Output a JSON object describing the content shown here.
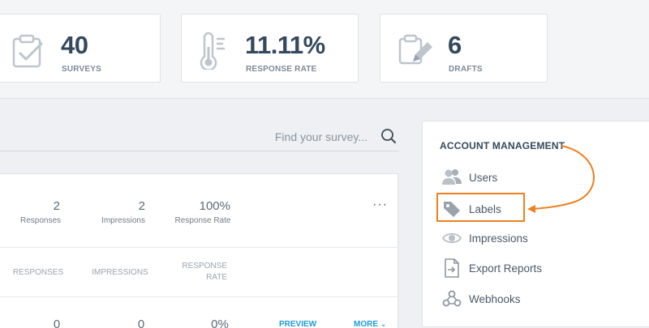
{
  "stats": [
    {
      "value": "40",
      "label": "SURVEYS",
      "icon": "clipboard-check-icon"
    },
    {
      "value": "11.11%",
      "label": "RESPONSE RATE",
      "icon": "thermometer-icon"
    },
    {
      "value": "6",
      "label": "DRAFTS",
      "icon": "clipboard-edit-icon"
    }
  ],
  "search": {
    "placeholder": "Find your survey..."
  },
  "survey_summary": {
    "responses": {
      "value": "2",
      "caption": "Responses"
    },
    "impressions": {
      "value": "2",
      "caption": "Impressions"
    },
    "response_rate": {
      "value": "100%",
      "caption": "Response Rate"
    },
    "more_menu": "···"
  },
  "table": {
    "headers": {
      "responses": "RESPONSES",
      "impressions": "IMPRESSIONS",
      "response_rate_1": "RESPONSE",
      "response_rate_2": "RATE"
    },
    "row": {
      "responses": "0",
      "impressions": "0",
      "response_rate": "0%",
      "preview": "PREVIEW",
      "more": "MORE"
    }
  },
  "account_management": {
    "title": "ACCOUNT MANAGEMENT",
    "items": [
      {
        "label": "Users",
        "icon": "users-icon"
      },
      {
        "label": "Labels",
        "icon": "tag-icon"
      },
      {
        "label": "Impressions",
        "icon": "eye-icon"
      },
      {
        "label": "Export Reports",
        "icon": "export-file-icon"
      },
      {
        "label": "Webhooks",
        "icon": "webhook-icon"
      }
    ]
  },
  "colors": {
    "accent": "#f07f1d",
    "link": "#1e9bd7",
    "text": "#34495e",
    "icon": "#b9c0c7"
  }
}
